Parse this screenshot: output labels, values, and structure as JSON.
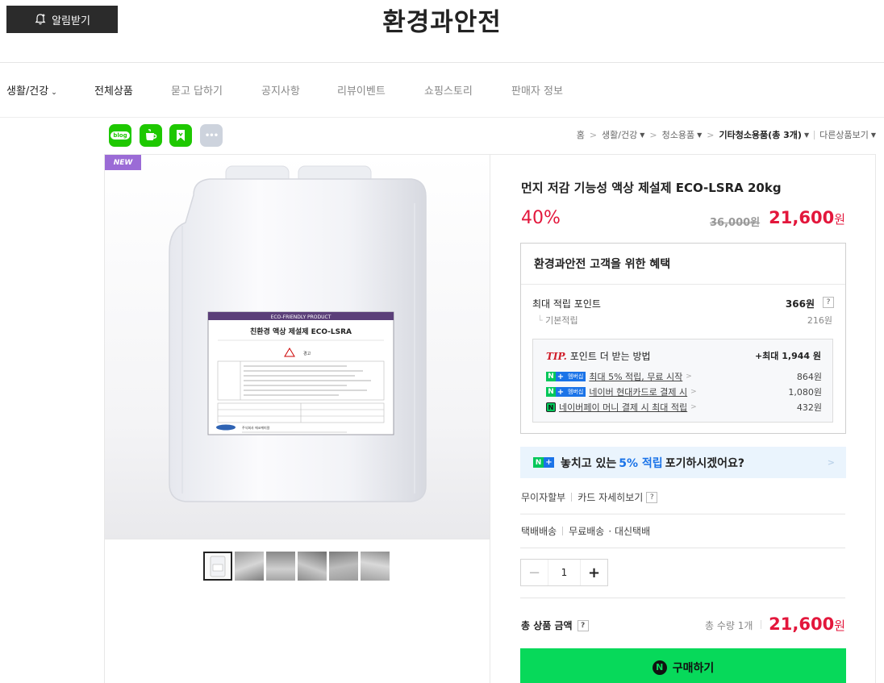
{
  "header": {
    "notify_label": "알림받기",
    "store_title": "환경과안전"
  },
  "nav": {
    "category": "생활/건강",
    "items": [
      "전체상품",
      "묻고 답하기",
      "공지사항",
      "리뷰이벤트",
      "쇼핑스토리",
      "판매자 정보"
    ]
  },
  "share": {
    "blog_label": "blog",
    "more_label": "•••"
  },
  "breadcrumb": {
    "home": "홈",
    "level1": "생활/건강",
    "level2": "청소용품",
    "level3": "기타청소용품(총 3개)",
    "other": "다른상품보기"
  },
  "product": {
    "badge": "NEW",
    "label_lines": {
      "header": "ECO-FRIENDLY PRODUCT",
      "name": "친환경 액상 제설제 ECO-LSRA",
      "warning": "경고",
      "company": "주식회사 에코케미칼"
    },
    "title": "먼지 저감 기능성 액상 제설제 ECO-LSRA 20kg",
    "discount": "40%",
    "original_price": "36,000원",
    "sale_price": "21,600",
    "currency": "원"
  },
  "benefits": {
    "title": "환경과안전 고객을 위한 혜택",
    "max_points_label": "최대 적립 포인트",
    "max_points_value": "366원",
    "q": "?",
    "basic_label": "기본적립",
    "basic_value": "216원",
    "tip_word": "TIP.",
    "tip_title": "포인트 더 받는 방법",
    "tip_max": "+최대 1,944 원",
    "membership_badge": "멤버십",
    "rows": [
      {
        "text": "최대 5% 적립, 무료 시작",
        "value": "864원"
      },
      {
        "text": "네이버 현대카드로 결제 시",
        "value": "1,080원"
      },
      {
        "text": "네이버페이 머니 결제 시 최대 적립",
        "value": "432원"
      }
    ]
  },
  "promo": {
    "before": "놓치고 있는",
    "highlight": "5% 적립",
    "after": "포기하시겠어요?"
  },
  "payment": {
    "installment": "무이자할부",
    "card_detail": "카드 자세히보기"
  },
  "shipping": {
    "method": "택배배송",
    "fee": "무료배송",
    "extra": "· 대신택배"
  },
  "quantity": {
    "value": "1",
    "minus": "−",
    "plus": "+"
  },
  "total": {
    "label": "총 상품 금액",
    "qty_text": "총 수량 1개",
    "price": "21,600",
    "currency": "원"
  },
  "buy": {
    "label": "구매하기",
    "n": "N"
  },
  "colors": {
    "accent_red": "#e3173c",
    "naver_green": "#07d95a",
    "badge_purple": "#9b6bd6"
  }
}
